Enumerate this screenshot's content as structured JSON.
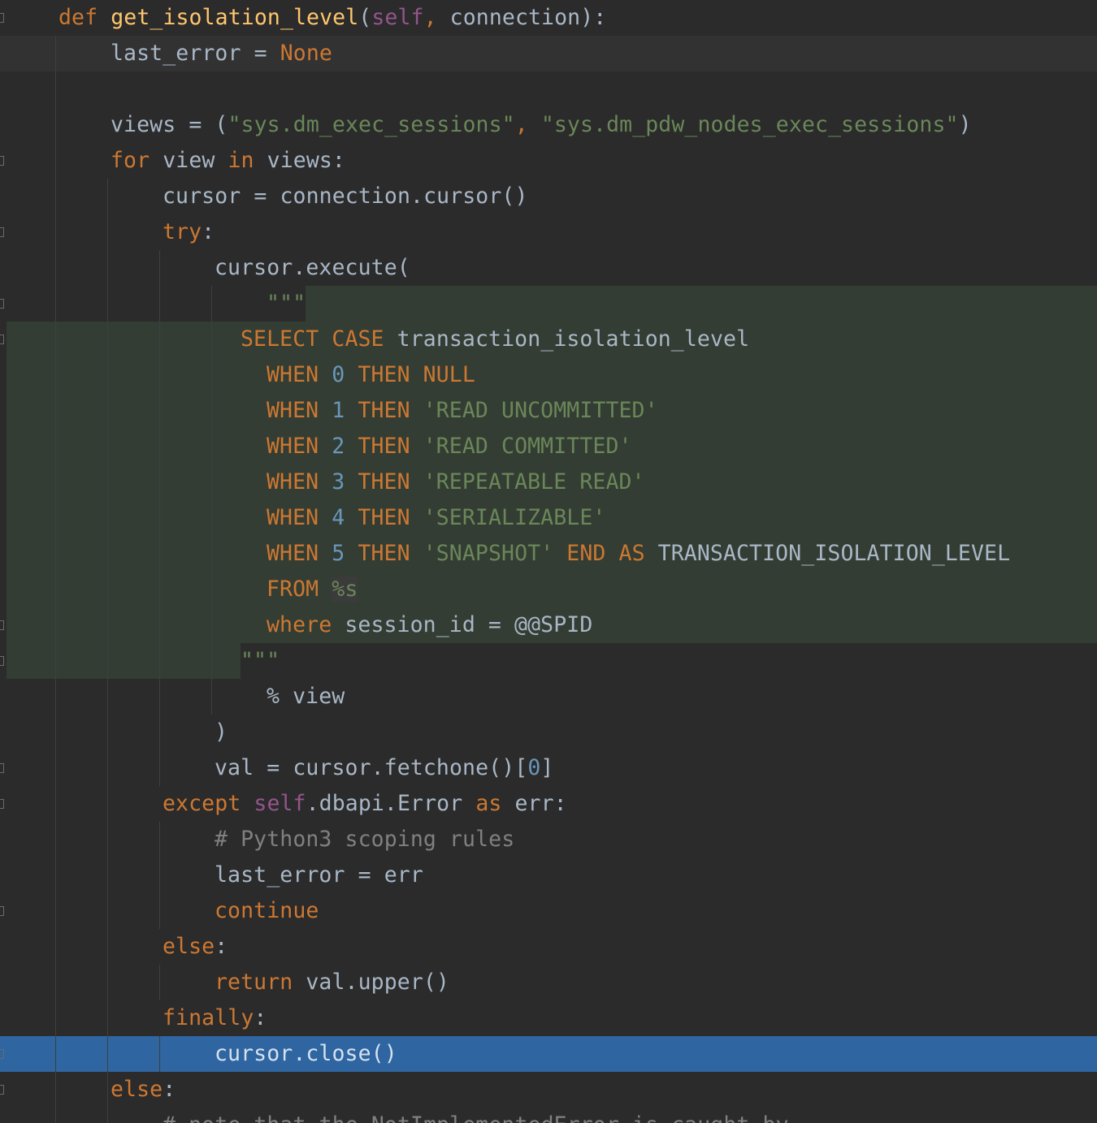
{
  "editor": {
    "colors": {
      "background": "#2b2b2b",
      "keyword": "#cc7832",
      "function": "#ffc66d",
      "string": "#6a8759",
      "number": "#6897bb",
      "comment": "#808080",
      "self": "#94558d",
      "injected_sql_bg": "#343d33",
      "selected_line_bg": "#2f65a0"
    },
    "lines": [
      {
        "indent": "  ",
        "tokens": [
          {
            "t": "def",
            "c": "kw"
          },
          {
            "t": " ",
            "c": "norm"
          },
          {
            "t": "get_isolation_level",
            "c": "fn"
          },
          {
            "t": "(",
            "c": "norm"
          },
          {
            "t": "self",
            "c": "self"
          },
          {
            "t": ",",
            "c": "kw"
          },
          {
            "t": " connection):",
            "c": "norm"
          }
        ]
      },
      {
        "indent": "    ",
        "tokens": [
          {
            "t": "last_error = ",
            "c": "norm"
          },
          {
            "t": "None",
            "c": "kw"
          }
        ]
      },
      {
        "indent": "",
        "tokens": []
      },
      {
        "indent": "    ",
        "tokens": [
          {
            "t": "views = (",
            "c": "norm"
          },
          {
            "t": "\"sys.dm_exec_sessions\"",
            "c": "str"
          },
          {
            "t": ", ",
            "c": "kw"
          },
          {
            "t": "\"sys.dm_pdw_nodes_exec_sessions\"",
            "c": "str"
          },
          {
            "t": ")",
            "c": "norm"
          }
        ]
      },
      {
        "indent": "    ",
        "tokens": [
          {
            "t": "for",
            "c": "kw"
          },
          {
            "t": " view ",
            "c": "norm"
          },
          {
            "t": "in",
            "c": "kw"
          },
          {
            "t": " views:",
            "c": "norm"
          }
        ]
      },
      {
        "indent": "      ",
        "tokens": [
          {
            "t": "cursor = connection.cursor()",
            "c": "norm"
          }
        ]
      },
      {
        "indent": "      ",
        "tokens": [
          {
            "t": "try",
            "c": "kw"
          },
          {
            "t": ":",
            "c": "norm"
          }
        ]
      },
      {
        "indent": "        ",
        "tokens": [
          {
            "t": "cursor.execute(",
            "c": "norm"
          }
        ]
      },
      {
        "indent": "          ",
        "tokens": [
          {
            "t": "\"\"\"",
            "c": "str"
          }
        ]
      },
      {
        "indent": "         ",
        "tokens": [
          {
            "t": "SELECT",
            "c": "kw"
          },
          {
            "t": " ",
            "c": "norm"
          },
          {
            "t": "CASE",
            "c": "kw"
          },
          {
            "t": " transaction_isolation_level",
            "c": "norm"
          }
        ]
      },
      {
        "indent": "          ",
        "tokens": [
          {
            "t": "WHEN",
            "c": "kw"
          },
          {
            "t": " ",
            "c": "norm"
          },
          {
            "t": "0",
            "c": "num"
          },
          {
            "t": " ",
            "c": "norm"
          },
          {
            "t": "THEN NULL",
            "c": "kw"
          }
        ]
      },
      {
        "indent": "          ",
        "tokens": [
          {
            "t": "WHEN",
            "c": "kw"
          },
          {
            "t": " ",
            "c": "norm"
          },
          {
            "t": "1",
            "c": "num"
          },
          {
            "t": " ",
            "c": "norm"
          },
          {
            "t": "THEN",
            "c": "kw"
          },
          {
            "t": " ",
            "c": "norm"
          },
          {
            "t": "'READ UNCOMMITTED'",
            "c": "str"
          }
        ]
      },
      {
        "indent": "          ",
        "tokens": [
          {
            "t": "WHEN",
            "c": "kw"
          },
          {
            "t": " ",
            "c": "norm"
          },
          {
            "t": "2",
            "c": "num"
          },
          {
            "t": " ",
            "c": "norm"
          },
          {
            "t": "THEN",
            "c": "kw"
          },
          {
            "t": " ",
            "c": "norm"
          },
          {
            "t": "'READ COMMITTED'",
            "c": "str"
          }
        ]
      },
      {
        "indent": "          ",
        "tokens": [
          {
            "t": "WHEN",
            "c": "kw"
          },
          {
            "t": " ",
            "c": "norm"
          },
          {
            "t": "3",
            "c": "num"
          },
          {
            "t": " ",
            "c": "norm"
          },
          {
            "t": "THEN",
            "c": "kw"
          },
          {
            "t": " ",
            "c": "norm"
          },
          {
            "t": "'REPEATABLE READ'",
            "c": "str"
          }
        ]
      },
      {
        "indent": "          ",
        "tokens": [
          {
            "t": "WHEN",
            "c": "kw"
          },
          {
            "t": " ",
            "c": "norm"
          },
          {
            "t": "4",
            "c": "num"
          },
          {
            "t": " ",
            "c": "norm"
          },
          {
            "t": "THEN",
            "c": "kw"
          },
          {
            "t": " ",
            "c": "norm"
          },
          {
            "t": "'SERIALIZABLE'",
            "c": "str"
          }
        ]
      },
      {
        "indent": "          ",
        "tokens": [
          {
            "t": "WHEN",
            "c": "kw"
          },
          {
            "t": " ",
            "c": "norm"
          },
          {
            "t": "5",
            "c": "num"
          },
          {
            "t": " ",
            "c": "norm"
          },
          {
            "t": "THEN",
            "c": "kw"
          },
          {
            "t": " ",
            "c": "norm"
          },
          {
            "t": "'SNAPSHOT'",
            "c": "str"
          },
          {
            "t": " ",
            "c": "norm"
          },
          {
            "t": "END AS",
            "c": "kw"
          },
          {
            "t": " TRANSACTION_ISOLATION_LEVEL",
            "c": "norm"
          }
        ]
      },
      {
        "indent": "          ",
        "tokens": [
          {
            "t": "FROM",
            "c": "kw"
          },
          {
            "t": " ",
            "c": "norm"
          },
          {
            "t": "%s",
            "c": "str ph"
          }
        ]
      },
      {
        "indent": "          ",
        "tokens": [
          {
            "t": "where",
            "c": "kw"
          },
          {
            "t": " session_id = @@SPID",
            "c": "norm"
          }
        ]
      },
      {
        "indent": "         ",
        "tokens": [
          {
            "t": "\"\"\"",
            "c": "str"
          }
        ]
      },
      {
        "indent": "          ",
        "tokens": [
          {
            "t": "% view",
            "c": "norm"
          }
        ]
      },
      {
        "indent": "        ",
        "tokens": [
          {
            "t": ")",
            "c": "norm"
          }
        ]
      },
      {
        "indent": "        ",
        "tokens": [
          {
            "t": "val = cursor.fetchone()[",
            "c": "norm"
          },
          {
            "t": "0",
            "c": "num"
          },
          {
            "t": "]",
            "c": "norm"
          }
        ]
      },
      {
        "indent": "      ",
        "tokens": [
          {
            "t": "except",
            "c": "kw"
          },
          {
            "t": " ",
            "c": "norm"
          },
          {
            "t": "self",
            "c": "self"
          },
          {
            "t": ".dbapi.Error ",
            "c": "norm"
          },
          {
            "t": "as",
            "c": "kw"
          },
          {
            "t": " err:",
            "c": "norm"
          }
        ]
      },
      {
        "indent": "        ",
        "tokens": [
          {
            "t": "# Python3 scoping rules",
            "c": "cm"
          }
        ]
      },
      {
        "indent": "        ",
        "tokens": [
          {
            "t": "last_error = err",
            "c": "norm"
          }
        ]
      },
      {
        "indent": "        ",
        "tokens": [
          {
            "t": "continue",
            "c": "kw"
          }
        ]
      },
      {
        "indent": "      ",
        "tokens": [
          {
            "t": "else",
            "c": "kw"
          },
          {
            "t": ":",
            "c": "norm"
          }
        ]
      },
      {
        "indent": "        ",
        "tokens": [
          {
            "t": "return",
            "c": "kw"
          },
          {
            "t": " val.upper()",
            "c": "norm"
          }
        ]
      },
      {
        "indent": "      ",
        "tokens": [
          {
            "t": "finally",
            "c": "kw"
          },
          {
            "t": ":",
            "c": "norm"
          }
        ]
      },
      {
        "indent": "        ",
        "tokens": [
          {
            "t": "cursor.close()",
            "c": "norm"
          }
        ]
      },
      {
        "indent": "    ",
        "tokens": [
          {
            "t": "else",
            "c": "kw"
          },
          {
            "t": ":",
            "c": "norm"
          }
        ]
      },
      {
        "indent": "      ",
        "tokens": [
          {
            "t": "# note that the NotImplementedError is caught by",
            "c": "cm"
          }
        ]
      }
    ]
  }
}
